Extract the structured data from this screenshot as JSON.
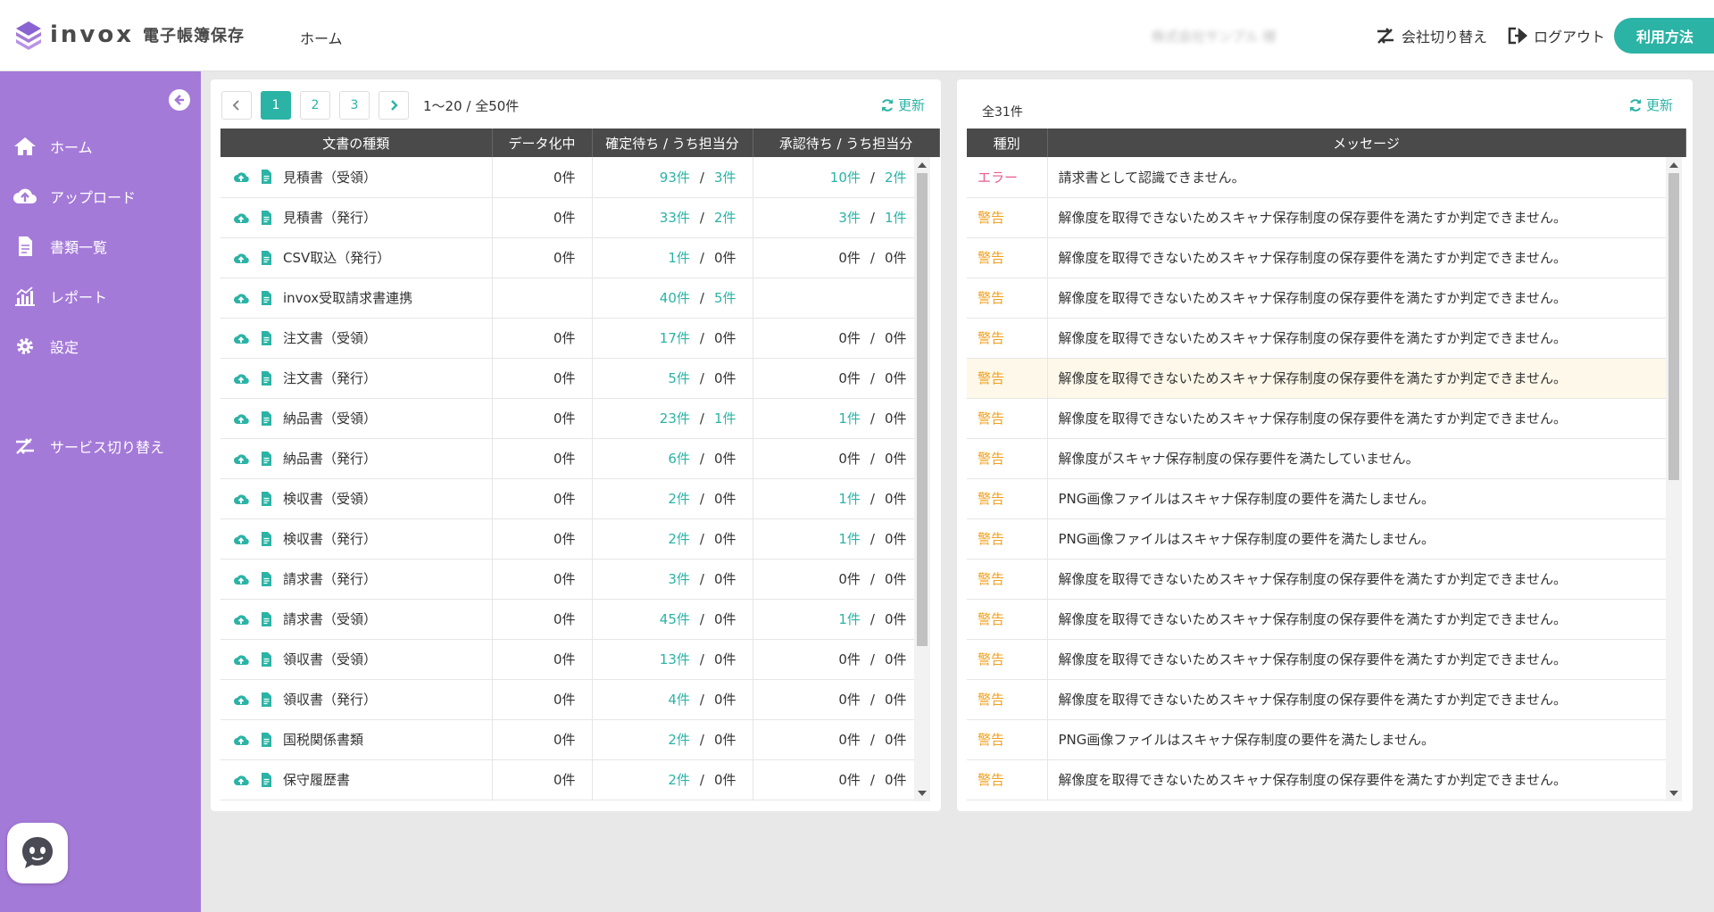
{
  "header": {
    "brand": "invox",
    "brand_sub": "電子帳簿保存",
    "home": "ホーム",
    "company": "株式会社サンプル 様",
    "switch_company": "会社切り替え",
    "logout": "ログアウト",
    "usage": "利用方法"
  },
  "sidebar": {
    "items": [
      {
        "label": "ホーム",
        "icon": "home-icon"
      },
      {
        "label": "アップロード",
        "icon": "cloud-upload-icon"
      },
      {
        "label": "書類一覧",
        "icon": "document-icon"
      },
      {
        "label": "レポート",
        "icon": "chart-icon"
      },
      {
        "label": "設定",
        "icon": "gear-icon"
      },
      {
        "label": "サービス切り替え",
        "icon": "switch-icon"
      }
    ]
  },
  "left_panel": {
    "pages": [
      "1",
      "2",
      "3"
    ],
    "active_page": "1",
    "range_info": "1〜20 / 全50件",
    "refresh": "更新",
    "columns": [
      "文書の種類",
      "データ化中",
      "確定待ち / うち担当分",
      "承認待ち / うち担当分"
    ],
    "rows": [
      {
        "name": "見積書（受領）",
        "processing": "0件",
        "confirm": "93件",
        "confirm_mine": "3件",
        "approve": "10件",
        "approve_mine": "2件",
        "c_link": true,
        "cm_link": true,
        "a_link": true,
        "am_link": true
      },
      {
        "name": "見積書（発行）",
        "processing": "0件",
        "confirm": "33件",
        "confirm_mine": "2件",
        "approve": "3件",
        "approve_mine": "1件",
        "c_link": true,
        "cm_link": true,
        "a_link": true,
        "am_link": true
      },
      {
        "name": "CSV取込（発行）",
        "processing": "0件",
        "confirm": "1件",
        "confirm_mine": "0件",
        "approve": "0件",
        "approve_mine": "0件",
        "c_link": true,
        "cm_link": false,
        "a_link": false,
        "am_link": false
      },
      {
        "name": "invox受取請求書連携",
        "processing": "",
        "confirm": "40件",
        "confirm_mine": "5件",
        "approve": "",
        "approve_mine": "",
        "c_link": true,
        "cm_link": true,
        "a_link": false,
        "am_link": false
      },
      {
        "name": "注文書（受領）",
        "processing": "0件",
        "confirm": "17件",
        "confirm_mine": "0件",
        "approve": "0件",
        "approve_mine": "0件",
        "c_link": true,
        "cm_link": false,
        "a_link": false,
        "am_link": false
      },
      {
        "name": "注文書（発行）",
        "processing": "0件",
        "confirm": "5件",
        "confirm_mine": "0件",
        "approve": "0件",
        "approve_mine": "0件",
        "c_link": true,
        "cm_link": false,
        "a_link": false,
        "am_link": false
      },
      {
        "name": "納品書（受領）",
        "processing": "0件",
        "confirm": "23件",
        "confirm_mine": "1件",
        "approve": "1件",
        "approve_mine": "0件",
        "c_link": true,
        "cm_link": true,
        "a_link": true,
        "am_link": false
      },
      {
        "name": "納品書（発行）",
        "processing": "0件",
        "confirm": "6件",
        "confirm_mine": "0件",
        "approve": "0件",
        "approve_mine": "0件",
        "c_link": true,
        "cm_link": false,
        "a_link": false,
        "am_link": false
      },
      {
        "name": "検収書（受領）",
        "processing": "0件",
        "confirm": "2件",
        "confirm_mine": "0件",
        "approve": "1件",
        "approve_mine": "0件",
        "c_link": true,
        "cm_link": false,
        "a_link": true,
        "am_link": false
      },
      {
        "name": "検収書（発行）",
        "processing": "0件",
        "confirm": "2件",
        "confirm_mine": "0件",
        "approve": "1件",
        "approve_mine": "0件",
        "c_link": true,
        "cm_link": false,
        "a_link": true,
        "am_link": false
      },
      {
        "name": "請求書（発行）",
        "processing": "0件",
        "confirm": "3件",
        "confirm_mine": "0件",
        "approve": "0件",
        "approve_mine": "0件",
        "c_link": true,
        "cm_link": false,
        "a_link": false,
        "am_link": false
      },
      {
        "name": "請求書（受領）",
        "processing": "0件",
        "confirm": "45件",
        "confirm_mine": "0件",
        "approve": "1件",
        "approve_mine": "0件",
        "c_link": true,
        "cm_link": false,
        "a_link": true,
        "am_link": false
      },
      {
        "name": "領収書（受領）",
        "processing": "0件",
        "confirm": "13件",
        "confirm_mine": "0件",
        "approve": "0件",
        "approve_mine": "0件",
        "c_link": true,
        "cm_link": false,
        "a_link": false,
        "am_link": false
      },
      {
        "name": "領収書（発行）",
        "processing": "0件",
        "confirm": "4件",
        "confirm_mine": "0件",
        "approve": "0件",
        "approve_mine": "0件",
        "c_link": true,
        "cm_link": false,
        "a_link": false,
        "am_link": false
      },
      {
        "name": "国税関係書類",
        "processing": "0件",
        "confirm": "2件",
        "confirm_mine": "0件",
        "approve": "0件",
        "approve_mine": "0件",
        "c_link": true,
        "cm_link": false,
        "a_link": false,
        "am_link": false
      },
      {
        "name": "保守履歴書",
        "processing": "0件",
        "confirm": "2件",
        "confirm_mine": "0件",
        "approve": "0件",
        "approve_mine": "0件",
        "c_link": true,
        "cm_link": false,
        "a_link": false,
        "am_link": false
      }
    ],
    "separator": "/"
  },
  "right_panel": {
    "total": "全31件",
    "refresh": "更新",
    "columns": [
      "種別",
      "メッセージ"
    ],
    "rows": [
      {
        "kind": "エラー",
        "type": "error",
        "message": "請求書として認識できません。"
      },
      {
        "kind": "警告",
        "type": "warn",
        "message": "解像度を取得できないためスキャナ保存制度の保存要件を満たすか判定できません。"
      },
      {
        "kind": "警告",
        "type": "warn",
        "message": "解像度を取得できないためスキャナ保存制度の保存要件を満たすか判定できません。"
      },
      {
        "kind": "警告",
        "type": "warn",
        "message": "解像度を取得できないためスキャナ保存制度の保存要件を満たすか判定できません。"
      },
      {
        "kind": "警告",
        "type": "warn",
        "message": "解像度を取得できないためスキャナ保存制度の保存要件を満たすか判定できません。"
      },
      {
        "kind": "警告",
        "type": "warn",
        "message": "解像度を取得できないためスキャナ保存制度の保存要件を満たすか判定できません。",
        "highlight": true
      },
      {
        "kind": "警告",
        "type": "warn",
        "message": "解像度を取得できないためスキャナ保存制度の保存要件を満たすか判定できません。"
      },
      {
        "kind": "警告",
        "type": "warn",
        "message": "解像度がスキャナ保存制度の保存要件を満たしていません。"
      },
      {
        "kind": "警告",
        "type": "warn",
        "message": "PNG画像ファイルはスキャナ保存制度の要件を満たしません。"
      },
      {
        "kind": "警告",
        "type": "warn",
        "message": "PNG画像ファイルはスキャナ保存制度の要件を満たしません。"
      },
      {
        "kind": "警告",
        "type": "warn",
        "message": "解像度を取得できないためスキャナ保存制度の保存要件を満たすか判定できません。"
      },
      {
        "kind": "警告",
        "type": "warn",
        "message": "解像度を取得できないためスキャナ保存制度の保存要件を満たすか判定できません。"
      },
      {
        "kind": "警告",
        "type": "warn",
        "message": "解像度を取得できないためスキャナ保存制度の保存要件を満たすか判定できません。"
      },
      {
        "kind": "警告",
        "type": "warn",
        "message": "解像度を取得できないためスキャナ保存制度の保存要件を満たすか判定できません。"
      },
      {
        "kind": "警告",
        "type": "warn",
        "message": "PNG画像ファイルはスキャナ保存制度の要件を満たしません。"
      },
      {
        "kind": "警告",
        "type": "warn",
        "message": "解像度を取得できないためスキャナ保存制度の保存要件を満たすか判定できません。"
      }
    ]
  },
  "colors": {
    "accent": "#2bb3a5",
    "sidebar": "#a47ad8",
    "error": "#e85a8e",
    "warn": "#f0a020"
  }
}
